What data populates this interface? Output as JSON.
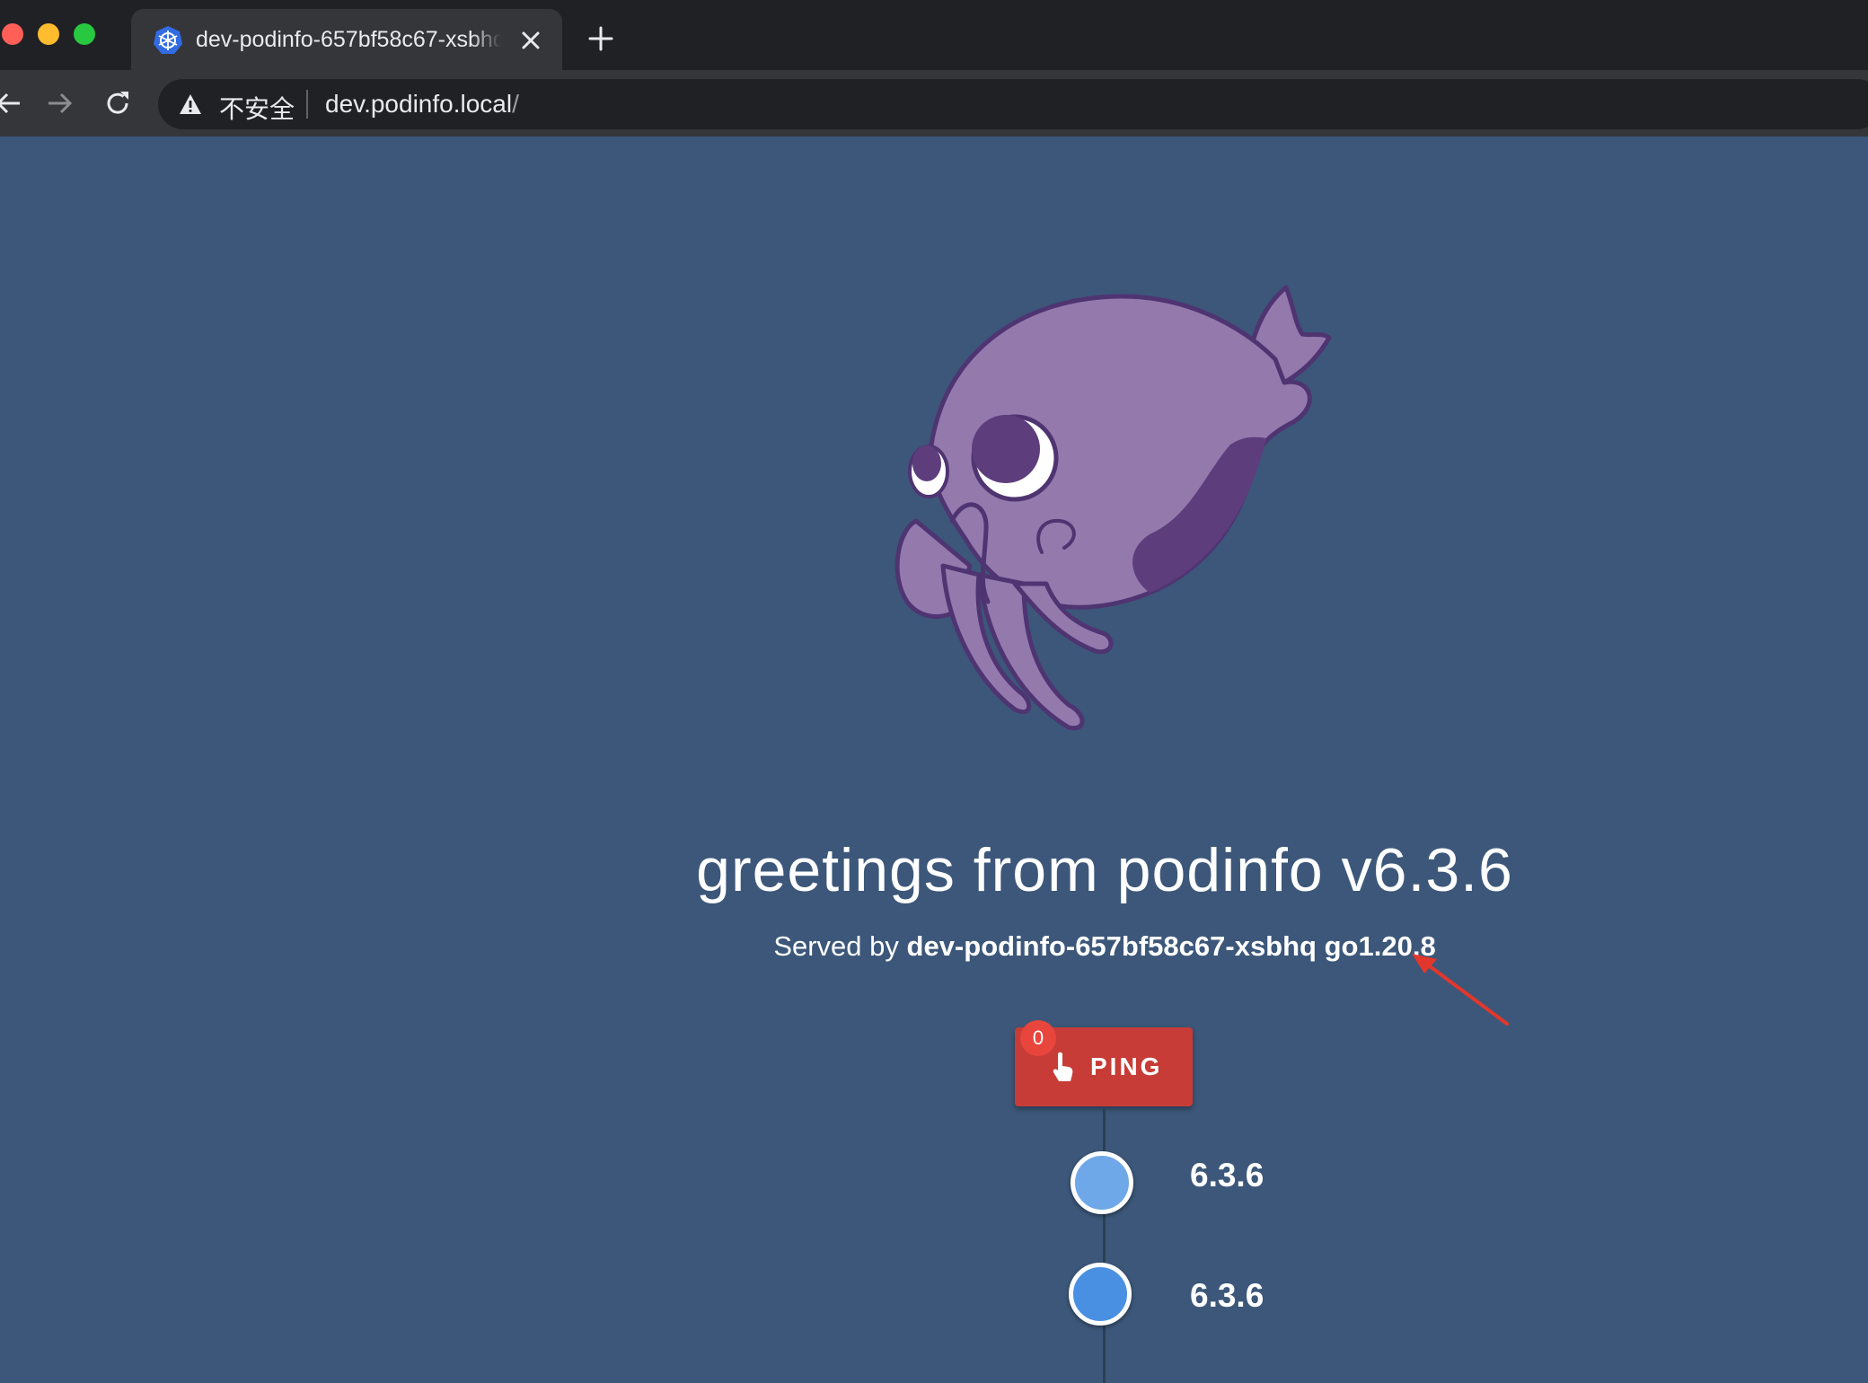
{
  "browser": {
    "tab_title": "dev-podinfo-657bf58c67-xsbhq",
    "security_label": "不安全",
    "url_host": "dev.podinfo.local",
    "url_path": "/"
  },
  "page": {
    "headline": "greetings from podinfo v6.3.6",
    "served_prefix": "Served by",
    "served_host": "dev-podinfo-657bf58c67-xsbhq",
    "served_runtime": "go1.20.8",
    "ping": {
      "label": "PING",
      "badge_count": "0"
    },
    "timeline": [
      {
        "version": "6.3.6",
        "color": "#6fa8e8"
      },
      {
        "version": "6.3.6",
        "color": "#4a90e2"
      }
    ]
  },
  "colors": {
    "page_background": "#3c5779",
    "ping_button": "#c73c36",
    "mascot_body": "#9479ad",
    "annotation_arrow": "#e2372c"
  },
  "icons": [
    "kubernetes-icon",
    "close-icon",
    "plus-icon",
    "back-arrow-icon",
    "forward-arrow-icon",
    "reload-icon",
    "warning-icon",
    "touch-icon"
  ]
}
